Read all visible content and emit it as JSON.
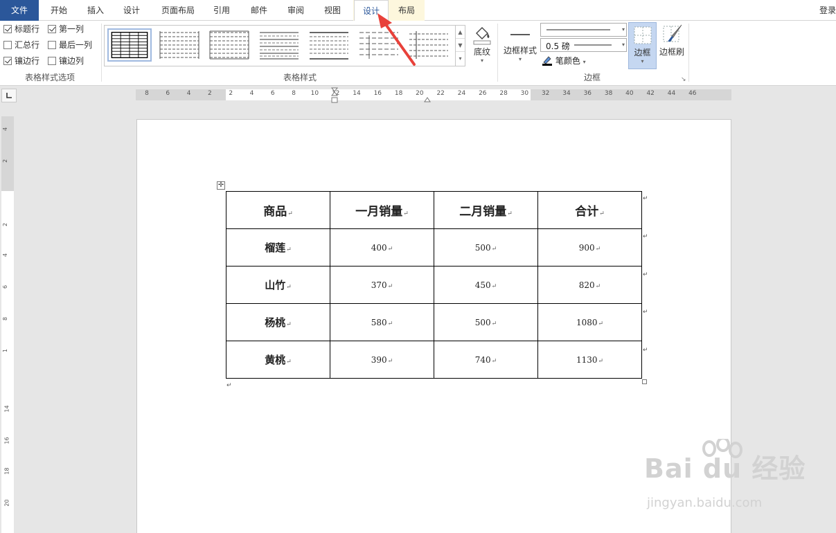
{
  "tabs": {
    "file": "文件",
    "items": [
      "开始",
      "插入",
      "设计",
      "页面布局",
      "引用",
      "邮件",
      "审阅",
      "视图"
    ],
    "context": [
      "设计",
      "布局"
    ],
    "login": "登录"
  },
  "style_options": {
    "items": [
      {
        "label": "标题行",
        "checked": true
      },
      {
        "label": "第一列",
        "checked": true
      },
      {
        "label": "汇总行",
        "checked": false
      },
      {
        "label": "最后一列",
        "checked": false
      },
      {
        "label": "镶边行",
        "checked": true
      },
      {
        "label": "镶边列",
        "checked": false
      }
    ],
    "group_label": "表格样式选项"
  },
  "table_styles": {
    "group_label": "表格样式",
    "shading_label": "底纹"
  },
  "borders": {
    "group_label": "边框",
    "border_style_label": "边框样式",
    "weight": "0.5 磅",
    "pen_color_label": "笔颜色",
    "borders_label": "边框",
    "painter_label": "边框刷"
  },
  "ruler": {
    "h_numbers": [
      "8",
      "6",
      "4",
      "2",
      "2",
      "4",
      "6",
      "8",
      "10",
      "12",
      "14",
      "16",
      "18",
      "20",
      "22",
      "24",
      "26",
      "28",
      "30",
      "32",
      "34",
      "36",
      "38",
      "40",
      "42",
      "44",
      "46"
    ],
    "v_numbers": [
      "4",
      "2",
      "2",
      "4",
      "6",
      "8",
      "1",
      "14",
      "16",
      "18",
      "20"
    ]
  },
  "table": {
    "headers": [
      "商品",
      "一月销量",
      "二月销量",
      "合计"
    ],
    "rows": [
      [
        "榴莲",
        "400",
        "500",
        "900"
      ],
      [
        "山竹",
        "370",
        "450",
        "820"
      ],
      [
        "杨桃",
        "580",
        "500",
        "1080"
      ],
      [
        "黄桃",
        "390",
        "740",
        "1130"
      ]
    ]
  },
  "watermark": {
    "brand": "Bai du 经验",
    "url": "jingyan.baidu.com"
  },
  "colors": {
    "file_tab": "#2b579a",
    "context_tab_bg": "#fdf7dd",
    "arrow": "#e8413a"
  }
}
